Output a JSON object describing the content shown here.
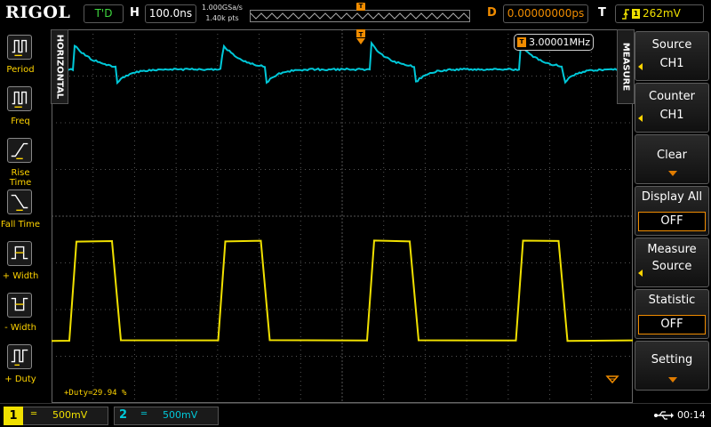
{
  "header": {
    "brand": "RIGOL",
    "run_state": "T'D",
    "timebase_label": "H",
    "timebase": "100.0ns",
    "sample_rate": "1.000GSa/s",
    "memory_depth": "1.40k pts",
    "delay_label": "D",
    "delay": "0.00000000ps",
    "trigger_label": "T",
    "trigger_level": "262mV",
    "trigger_source_icon": "trigger-channel-1-icon",
    "trigger_edge_icon": "rising-edge-icon"
  },
  "left_panel": {
    "items": [
      {
        "label": "Period",
        "icon": "period-icon"
      },
      {
        "label": "Freq",
        "icon": "frequency-icon"
      },
      {
        "label": "Rise Time",
        "icon": "rise-time-icon"
      },
      {
        "label": "Fall Time",
        "icon": "fall-time-icon"
      },
      {
        "label": "+ Width",
        "icon": "positive-width-icon"
      },
      {
        "label": "- Width",
        "icon": "negative-width-icon"
      },
      {
        "label": "+ Duty",
        "icon": "positive-duty-icon"
      }
    ],
    "tab_label": "HORIZONTAL"
  },
  "display": {
    "frequency_readout": "3.00001MHz",
    "duty_readout": "+Duty=29.94 %",
    "ch1_color": "#f0e000",
    "ch2_color": "#00c8d8",
    "trigger_color": "#f08c00"
  },
  "menu": {
    "tab_label": "MEASURE",
    "source": {
      "title": "Source",
      "value": "CH1"
    },
    "counter": {
      "title": "Counter",
      "value": "CH1"
    },
    "clear": {
      "title": "Clear"
    },
    "display_all": {
      "title": "Display All",
      "value": "OFF"
    },
    "measure_source": {
      "title": "Measure",
      "title2": "Source"
    },
    "statistic": {
      "title": "Statistic",
      "value": "OFF"
    },
    "setting": {
      "title": "Setting"
    }
  },
  "footer": {
    "ch1_number": "1",
    "ch1_scale": "500mV",
    "ch2_number": "2",
    "ch2_scale": "500mV",
    "coupling_symbol": "═",
    "time": "00:14"
  }
}
